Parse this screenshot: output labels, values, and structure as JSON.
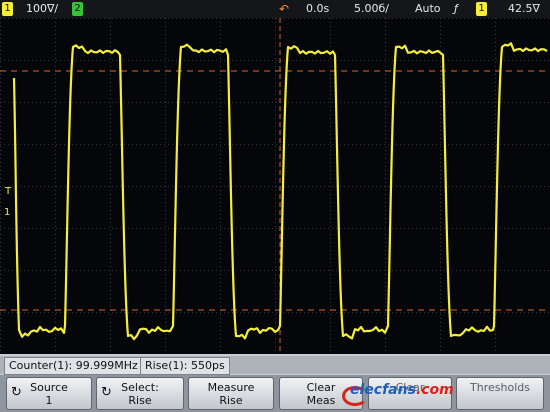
{
  "topbar": {
    "ch1_num": "1",
    "ch1_scale": "100∇/",
    "ch2_num": "2",
    "time_delay": "0.0s",
    "time_scale": "5.00б/",
    "trigger_mode": "Auto",
    "trigger_slope": "ƒ",
    "trigger_source": "1",
    "trigger_level": "42.5∇"
  },
  "measurements": {
    "counter": "Counter(1): 99.999MHz",
    "rise": "Rise(1): 550ps"
  },
  "softkeys": {
    "source_top": "Source",
    "source_bottom": "1",
    "select_top": "Select:",
    "select_bottom": "Rise",
    "measure_top": "Measure",
    "measure_bottom": "Rise",
    "clear_top": "Clear",
    "clear_bottom": "Meas",
    "clear2_top": "Clear",
    "thresholds_top": "Thresholds"
  },
  "watermark": {
    "brand": "elecfans",
    "suffix": ".com",
    "cn_text": "电子发烧友"
  },
  "colors": {
    "trace": "#f2ee3a",
    "marker_line": "#d9662c",
    "grid": "#5a5e66",
    "ch1": "#f2ee3a",
    "ch2": "#37c237"
  },
  "ground_marker": "T",
  "level_marker": "1"
}
